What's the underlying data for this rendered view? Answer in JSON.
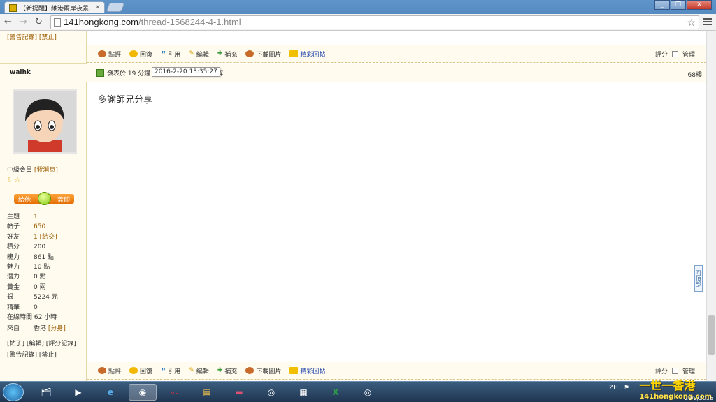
{
  "browser": {
    "tab_title": "【新提醒】維港兩岸夜景…",
    "url_host": "141hongkong.com",
    "url_path": "/thread-1568244-4-1.html"
  },
  "top_links": {
    "report": "[警告記錄]",
    "ban": "[禁止]"
  },
  "actions": {
    "rate": "點評",
    "reply": "回復",
    "quote": "引用",
    "edit": "編輯",
    "supplement": "補充",
    "download": "下載圖片",
    "best": "精彩回帖",
    "score": "評分",
    "manage": "管理"
  },
  "user": {
    "name": "waihk",
    "rank": "中級會員",
    "message": "[發消息]",
    "give_btn": "給他",
    "stamp_btn": "蓋印",
    "links1": "[帖子] [編輯] [評分記錄]",
    "links2": "[警告記錄] [禁止]"
  },
  "stats": [
    {
      "k": "主題",
      "v": "1"
    },
    {
      "k": "帖子",
      "v": "650"
    },
    {
      "k": "好友",
      "v": "1 [結交]"
    },
    {
      "k": "積分",
      "v": "200"
    },
    {
      "k": "魄力",
      "v": "861 點"
    },
    {
      "k": "魅力",
      "v": "10 點"
    },
    {
      "k": "潛力",
      "v": "0 點"
    },
    {
      "k": "黃金",
      "v": "0 兩"
    },
    {
      "k": "銀",
      "v": "5224 元"
    },
    {
      "k": "精華",
      "v": "0"
    }
  ],
  "online": "在線時間 62 小時",
  "from_label": "來自",
  "from_val": "香港",
  "from_link": "[分身]",
  "post": {
    "posted": "發表於 19 分鐘",
    "posted_suffix": "解",
    "tooltip": "2016-2-20 13:35:27",
    "floor": "68樓",
    "body": "多謝師兄分享"
  },
  "backtop": "回頂部",
  "taskbar": {
    "lang": "ZH",
    "brand": "一世一香港",
    "brand_sub": "141hongkong.com",
    "date": "20/2/2016"
  }
}
